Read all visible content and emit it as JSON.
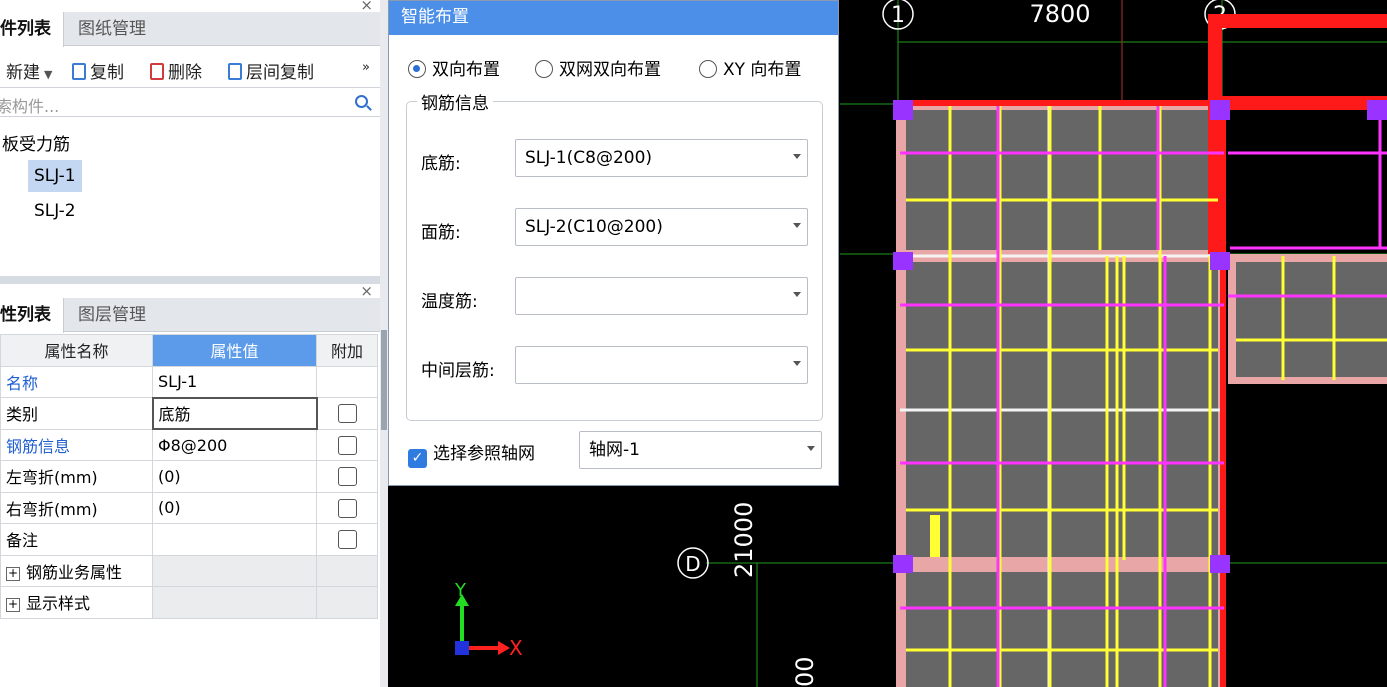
{
  "components_panel": {
    "tabs": [
      "件列表",
      "图纸管理"
    ],
    "close": "×",
    "toolbar": {
      "new": "新建",
      "copy": "复制",
      "delete": "删除",
      "floor_copy": "层间复制",
      "more": "»"
    },
    "search_placeholder": "索构件...",
    "tree": {
      "root": "板受力筋",
      "items": [
        "SLJ-1",
        "SLJ-2"
      ]
    }
  },
  "properties_panel": {
    "tabs": [
      "性列表",
      "图层管理"
    ],
    "close": "×",
    "headers": [
      "属性名称",
      "属性值",
      "附加"
    ],
    "rows": [
      {
        "name": "名称",
        "value": "SLJ-1"
      },
      {
        "name": "类别",
        "value": "底筋"
      },
      {
        "name": "钢筋信息",
        "value": "Φ8@200"
      },
      {
        "name": "左弯折(mm)",
        "value": "(0)"
      },
      {
        "name": "右弯折(mm)",
        "value": "(0)"
      },
      {
        "name": "备注",
        "value": ""
      },
      {
        "name": "钢筋业务属性",
        "value": ""
      },
      {
        "name": "显示样式",
        "value": ""
      }
    ]
  },
  "dialog": {
    "title": "智能布置",
    "radios": [
      "双向布置",
      "双网双向布置",
      "XY 向布置"
    ],
    "group_title": "钢筋信息",
    "fields": [
      {
        "label": "底筋:",
        "value": "SLJ-1(C8@200)"
      },
      {
        "label": "面筋:",
        "value": "SLJ-2(C10@200)"
      },
      {
        "label": "温度筋:",
        "value": ""
      },
      {
        "label": "中间层筋:",
        "value": ""
      }
    ],
    "axis_check_label": "选择参照轴网",
    "axis_value": "轴网-1"
  },
  "cad": {
    "axis_labels": [
      "1",
      "2",
      "D"
    ],
    "dimensions": [
      "7800",
      "21000",
      "00"
    ],
    "ucs": {
      "x": "X",
      "y": "Y"
    },
    "colors": {
      "background": "#000000",
      "beam": "#ff1a1a",
      "slab": "#6a6a6a",
      "rebar_x": "#ffff33",
      "rebar_y": "#ff33ff",
      "grid": "#1f9b1f"
    }
  }
}
